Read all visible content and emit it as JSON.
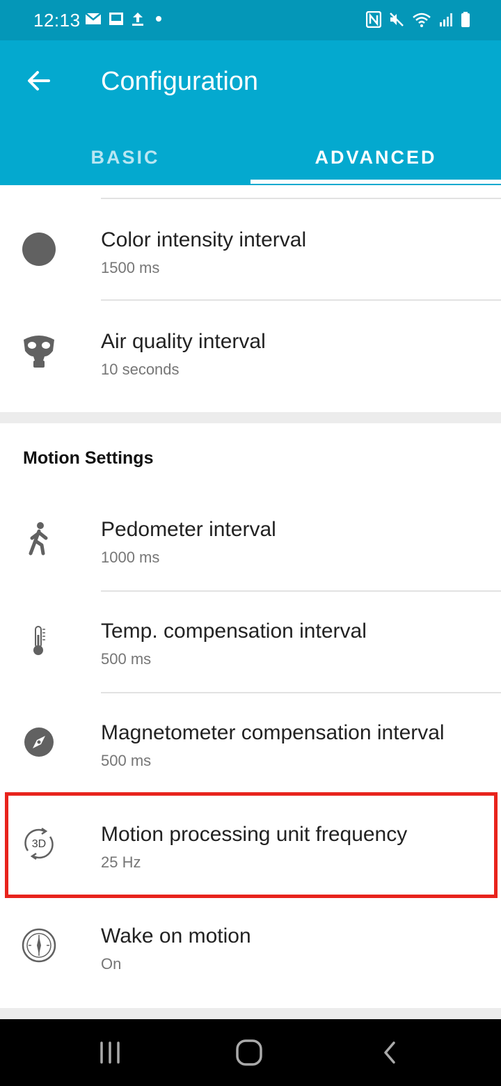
{
  "status": {
    "time": "12:13",
    "left_icons": [
      "mail-icon",
      "gallery-icon",
      "upload-icon",
      "dot-icon"
    ],
    "right_icons": [
      "nfc-icon",
      "mute-icon",
      "wifi-icon",
      "signal-icon",
      "battery-icon"
    ]
  },
  "appbar": {
    "title": "Configuration",
    "back_icon": "arrow-back-icon",
    "tabs": [
      {
        "label": "BASIC",
        "selected": false
      },
      {
        "label": "ADVANCED",
        "selected": true
      }
    ]
  },
  "environment_items": [
    {
      "icon": "color-circle-icon",
      "title": "Color intensity interval",
      "value": "1500 ms"
    },
    {
      "icon": "gas-mask-icon",
      "title": "Air quality interval",
      "value": "10 seconds"
    }
  ],
  "motion_section": {
    "title": "Motion Settings",
    "items": [
      {
        "icon": "walking-person-icon",
        "title": "Pedometer interval",
        "value": "1000 ms"
      },
      {
        "icon": "thermometer-icon",
        "title": "Temp. compensation interval",
        "value": "500 ms"
      },
      {
        "icon": "compass-icon",
        "title": "Magnetometer compensation interval",
        "value": "500 ms"
      },
      {
        "icon": "rotate-3d-icon",
        "title": "Motion processing unit frequency",
        "value": "25 Hz",
        "highlighted": true
      },
      {
        "icon": "dial-icon",
        "title": "Wake on motion",
        "value": "On"
      }
    ],
    "rotate_icon_text": "3D"
  },
  "colors": {
    "statusbar": "#0497b8",
    "appbar": "#04a9cf",
    "highlight": "#e8231c"
  },
  "navbar": [
    "recents-icon",
    "home-icon",
    "back-nav-icon"
  ]
}
